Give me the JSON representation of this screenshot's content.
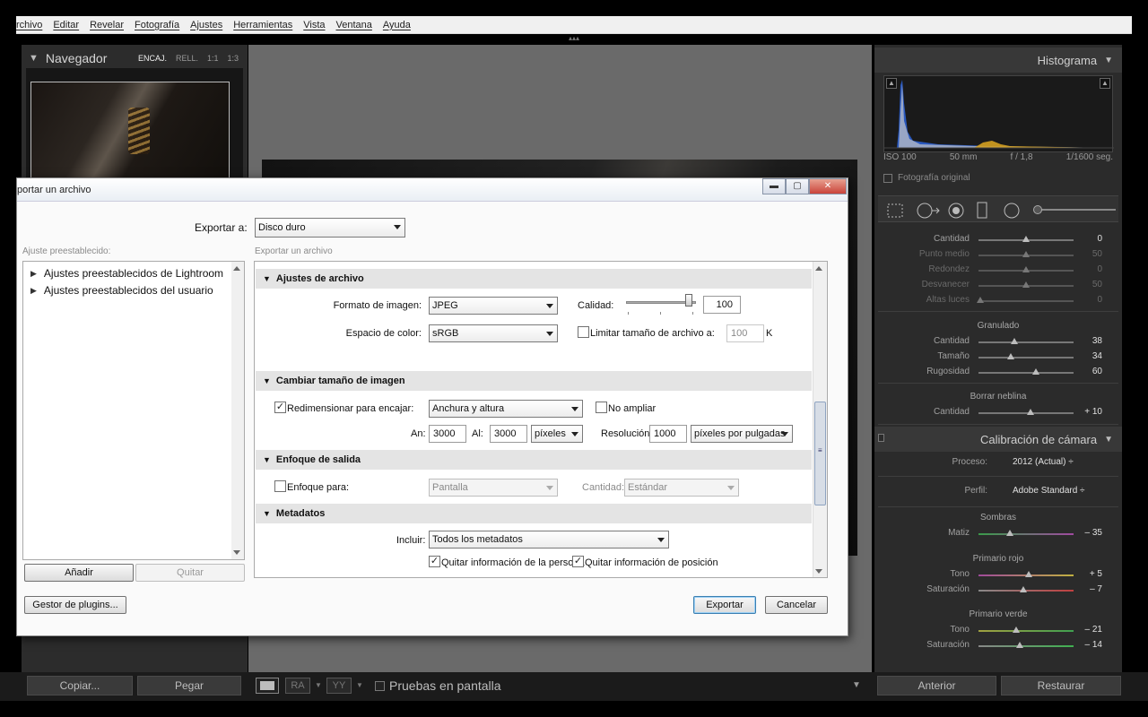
{
  "menu": [
    "rchivo",
    "Editar",
    "Revelar",
    "Fotografía",
    "Ajustes",
    "Herramientas",
    "Vista",
    "Ventana",
    "Ayuda"
  ],
  "navigator": {
    "title": "Navegador",
    "zoom_options": [
      "ENCAJ.",
      "RELL.",
      "1:1",
      "1:3"
    ],
    "active_zoom": "ENCAJ.",
    "copy_label": "Copiar...",
    "paste_label": "Pegar"
  },
  "right_panel": {
    "histogram_title": "Histograma",
    "info": {
      "iso": "ISO 100",
      "focal": "50 mm",
      "aperture": "f / 1,8",
      "shutter": "1/1600 seg."
    },
    "original_photo_label": "Fotografía original",
    "effects_partial": {
      "rows": [
        {
          "label": "Cantidad",
          "value": "0",
          "pos": 0.5,
          "dim": false
        },
        {
          "label": "Punto medio",
          "value": "50",
          "pos": 0.5,
          "dim": true
        },
        {
          "label": "Redondez",
          "value": "0",
          "pos": 0.5,
          "dim": true
        },
        {
          "label": "Desvanecer",
          "value": "50",
          "pos": 0.5,
          "dim": true
        },
        {
          "label": "Altas luces",
          "value": "0",
          "pos": 0.02,
          "dim": true
        }
      ]
    },
    "grain": {
      "title": "Granulado",
      "rows": [
        {
          "label": "Cantidad",
          "value": "38",
          "pos": 0.38
        },
        {
          "label": "Tamaño",
          "value": "34",
          "pos": 0.34
        },
        {
          "label": "Rugosidad",
          "value": "60",
          "pos": 0.6
        }
      ]
    },
    "dehaze": {
      "title": "Borrar neblina",
      "rows": [
        {
          "label": "Cantidad",
          "value": "+ 10",
          "pos": 0.55
        }
      ]
    },
    "calibration": {
      "title": "Calibración de cámara",
      "process_label": "Proceso:",
      "process_value": "2012 (Actual) ÷",
      "profile_label": "Perfil:",
      "profile_value": "Adobe Standard ÷",
      "shadows": {
        "title": "Sombras",
        "rows": [
          {
            "label": "Matiz",
            "value": "– 35",
            "pos": 0.33
          }
        ]
      },
      "red_primary": {
        "title": "Primario rojo",
        "rows": [
          {
            "label": "Tono",
            "value": "+ 5",
            "pos": 0.53
          },
          {
            "label": "Saturación",
            "value": "– 7",
            "pos": 0.47
          }
        ]
      },
      "green_primary": {
        "title": "Primario verde",
        "rows": [
          {
            "label": "Tono",
            "value": "– 21",
            "pos": 0.4
          },
          {
            "label": "Saturación",
            "value": "– 14",
            "pos": 0.43
          }
        ]
      }
    },
    "previous_label": "Anterior",
    "reset_label": "Restaurar"
  },
  "bottom_toolbar": {
    "proof_label": "Pruebas en pantalla",
    "compare_label": "RA",
    "survey_label": "YY"
  },
  "dialog": {
    "title": "portar un archivo",
    "export_to_label": "Exportar a:",
    "export_to_value": "Disco duro",
    "preset_label": "Ajuste preestablecido:",
    "presets": [
      "Ajustes preestablecidos de Lightroom",
      "Ajustes preestablecidos del usuario"
    ],
    "add_label": "Añadir",
    "remove_label": "Quitar",
    "subtitle": "Exportar un archivo",
    "plugin_manager_label": "Gestor de plugins...",
    "export_label": "Exportar",
    "cancel_label": "Cancelar",
    "file_settings": {
      "title": "Ajustes de archivo",
      "format_label": "Formato de imagen:",
      "format_value": "JPEG",
      "quality_label": "Calidad:",
      "quality_value": "100",
      "color_space_label": "Espacio de color:",
      "color_space_value": "sRGB",
      "limit_label": "Limitar tamaño de archivo a:",
      "limit_value": "100",
      "limit_unit": "K"
    },
    "resize": {
      "title": "Cambiar tamaño de imagen",
      "resize_label": "Redimensionar para encajar:",
      "resize_checked": true,
      "resize_mode": "Anchura y altura",
      "no_enlarge_label": "No ampliar",
      "width_label": "An:",
      "width_value": "3000",
      "height_label": "Al:",
      "height_value": "3000",
      "unit_value": "píxeles",
      "resolution_label": "Resolución:",
      "resolution_value": "1000",
      "resolution_unit": "píxeles por pulgadas"
    },
    "sharpen": {
      "title": "Enfoque de salida",
      "sharpen_label": "Enfoque para:",
      "sharpen_target": "Pantalla",
      "amount_label": "Cantidad:",
      "amount_value": "Estándar"
    },
    "metadata": {
      "title": "Metadatos",
      "include_label": "Incluir:",
      "include_value": "Todos los metadatos",
      "remove_person_label": "Quitar información de la persona",
      "remove_location_label": "Quitar información de posición"
    }
  }
}
